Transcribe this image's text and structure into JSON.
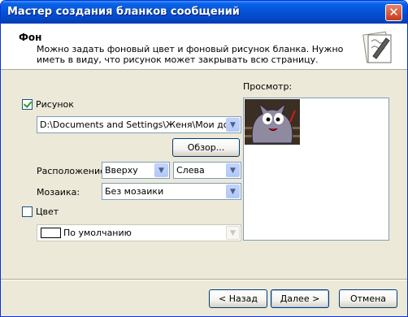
{
  "window": {
    "title": "Мастер создания бланков сообщений",
    "close_glyph": "✕"
  },
  "header": {
    "title": "Фон",
    "description": "Можно задать фоновый цвет и фоновый рисунок бланка. Нужно иметь в виду, что рисунок может закрывать всю страницу.",
    "icon": "stationery-pen-icon"
  },
  "picture": {
    "checkbox_label": "Рисунок",
    "checked": true,
    "path_value": "D:\\Documents and Settings\\Женя\\Мои докуме",
    "browse_label": "Обзор..."
  },
  "position": {
    "label": "Расположение:",
    "vertical_value": "Вверху",
    "horizontal_value": "Слева"
  },
  "tiling": {
    "label": "Мозаика:",
    "value": "Без мозаики"
  },
  "color": {
    "checkbox_label": "Цвет",
    "checked": false,
    "value": "По умолчанию",
    "swatch_color": "#ffffff"
  },
  "preview": {
    "label": "Просмотр:"
  },
  "buttons": {
    "back": "< Назад",
    "next": "Далее >",
    "cancel": "Отмена"
  },
  "colors": {
    "titlebar": "#0553d6",
    "window_bg": "#ece9d8",
    "accent_border": "#7f9db9"
  }
}
